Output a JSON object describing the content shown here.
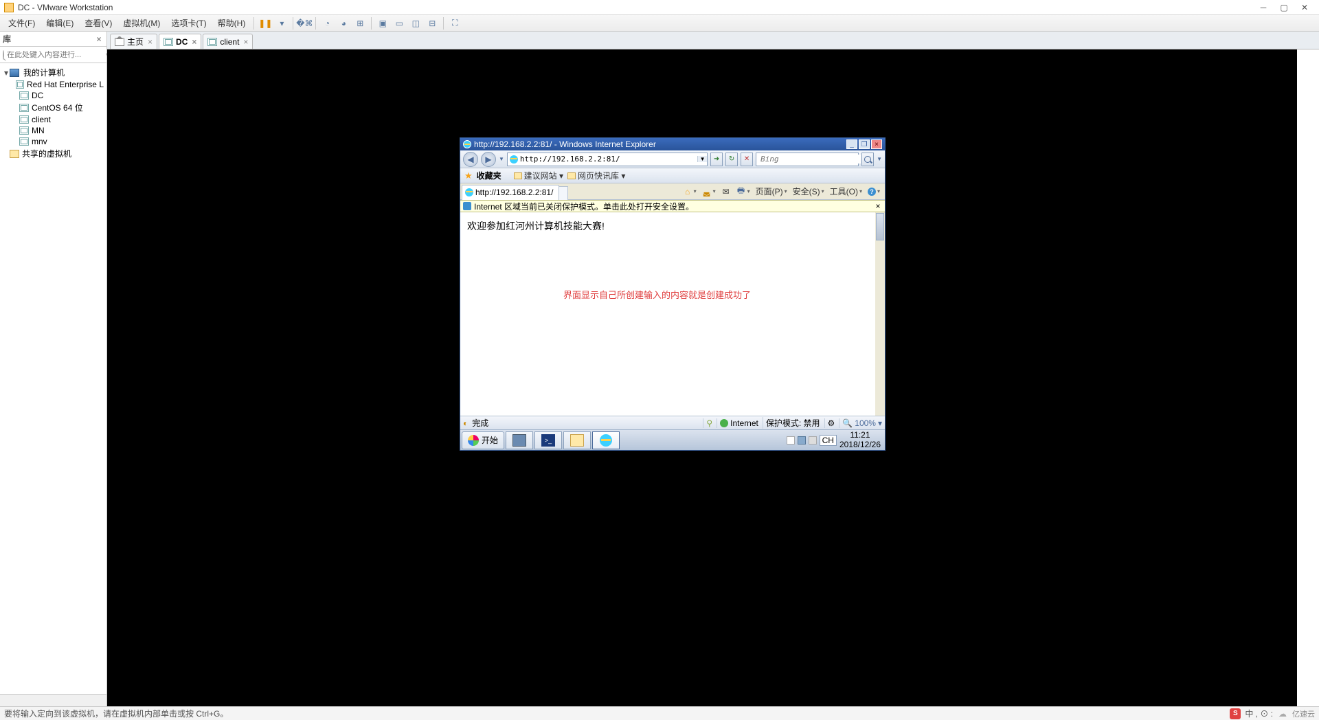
{
  "titlebar": {
    "title": "DC - VMware Workstation"
  },
  "menu": {
    "file": "文件(F)",
    "edit": "编辑(E)",
    "view": "查看(V)",
    "vm": "虚拟机(M)",
    "tabs": "选项卡(T)",
    "help": "帮助(H)"
  },
  "sidebar": {
    "header": "库",
    "search_placeholder": "在此处键入内容进行...",
    "root": "我的计算机",
    "items": [
      "Red Hat Enterprise L",
      "DC",
      "CentOS 64 位",
      "client",
      "MN",
      "mnv"
    ],
    "shared": "共享的虚拟机"
  },
  "tabs": [
    {
      "label": "主页",
      "type": "home"
    },
    {
      "label": "DC",
      "type": "vm",
      "active": true
    },
    {
      "label": "client",
      "type": "vm"
    }
  ],
  "ie": {
    "title": "http://192.168.2.2:81/ - Windows Internet Explorer",
    "url": "http://192.168.2.2:81/",
    "search_placeholder": "Bing",
    "fav_label": "收藏夹",
    "fav_items": [
      "建议网站 ▾",
      "网页快讯库 ▾"
    ],
    "tab_label": "http://192.168.2.2:81/",
    "cmd": {
      "page": "页面(P)",
      "safety": "安全(S)",
      "tools": "工具(O)"
    },
    "infobar": "Internet 区域当前已关闭保护模式。单击此处打开安全设置。",
    "page_text": "欢迎参加红河州计算机技能大赛!",
    "annotation": "界面显示自己所创建输入的内容就是创建成功了",
    "status_done": "完成",
    "status_zone": "Internet",
    "status_protected": "保护模式: 禁用",
    "status_zoom": "100%"
  },
  "vmtaskbar": {
    "start": "开始",
    "clock_time": "11:21",
    "clock_date": "2018/12/26",
    "lang": "CH"
  },
  "host_status": {
    "hint": "要将输入定向到该虚拟机，请在虚拟机内部单击或按 Ctrl+G。",
    "ime": "中 , ⊙ :",
    "brand": "亿速云"
  }
}
